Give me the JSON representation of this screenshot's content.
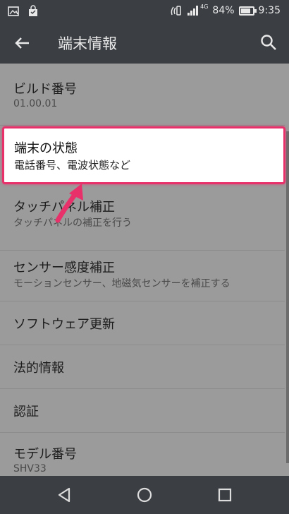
{
  "status_bar": {
    "network": "4G",
    "battery": "84%",
    "battery_level": 0.84,
    "time": "9:35"
  },
  "app_bar": {
    "title": "端末情報",
    "back_icon": "arrow-back-icon",
    "search_icon": "search-icon"
  },
  "items": [
    {
      "title": "ビルド番号",
      "subtitle": "01.00.01"
    },
    {
      "title": "端末の状態",
      "subtitle": "電話番号、電波状態など"
    },
    {
      "title": "タッチパネル補正",
      "subtitle": "タッチパネルの補正を行う"
    },
    {
      "title": "センサー感度補正",
      "subtitle": "モーションセンサー、地磁気センサーを補正する"
    },
    {
      "title": "ソフトウェア更新",
      "subtitle": ""
    },
    {
      "title": "法的情報",
      "subtitle": ""
    },
    {
      "title": "認証",
      "subtitle": ""
    },
    {
      "title": "モデル番号",
      "subtitle": "SHV33"
    }
  ],
  "colors": {
    "highlight": "#e8316b",
    "bar": "#3b3f44",
    "dim_background": "#9b9b9b"
  },
  "nav_bar": {
    "back": "nav-back-icon",
    "home": "nav-home-icon",
    "recents": "nav-recents-icon"
  }
}
